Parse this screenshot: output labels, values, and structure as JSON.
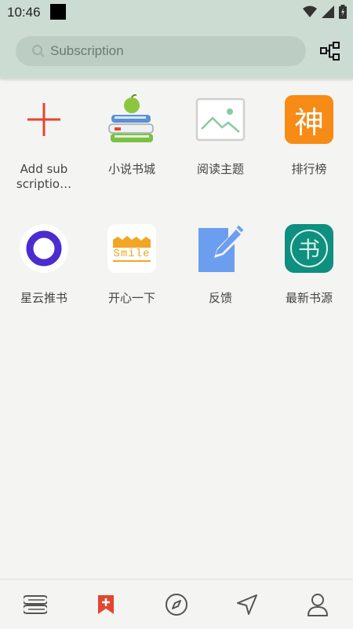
{
  "status": {
    "time": "10:46"
  },
  "search": {
    "placeholder": "Subscription"
  },
  "items": [
    {
      "label": "Add sub scriptio…",
      "icon": "add-icon"
    },
    {
      "label": "小说书城",
      "icon": "books-apple-icon"
    },
    {
      "label": "阅读主题",
      "icon": "image-icon"
    },
    {
      "label": "排行榜",
      "icon": "shen-icon",
      "glyph": "神"
    },
    {
      "label": "星云推书",
      "icon": "nebula-icon"
    },
    {
      "label": "开心一下",
      "icon": "smile-icon",
      "glyph": "Smile"
    },
    {
      "label": "反馈",
      "icon": "feedback-icon"
    },
    {
      "label": "最新书源",
      "icon": "book-source-icon",
      "glyph": "书"
    }
  ],
  "nav": [
    {
      "name": "bookshelf",
      "icon": "bookshelf-icon"
    },
    {
      "name": "subscription",
      "icon": "bookmark-icon",
      "active": true
    },
    {
      "name": "discover",
      "icon": "compass-icon"
    },
    {
      "name": "send",
      "icon": "navigation-icon"
    },
    {
      "name": "profile",
      "icon": "person-icon"
    }
  ],
  "colors": {
    "header_bg": "#ccdcd3",
    "accent": "#e2472f",
    "shen_orange": "#f68b16",
    "book_source_teal": "#0f8f7f",
    "nebula_purple": "#4a2ccf",
    "feedback_blue": "#6c9ef0"
  }
}
